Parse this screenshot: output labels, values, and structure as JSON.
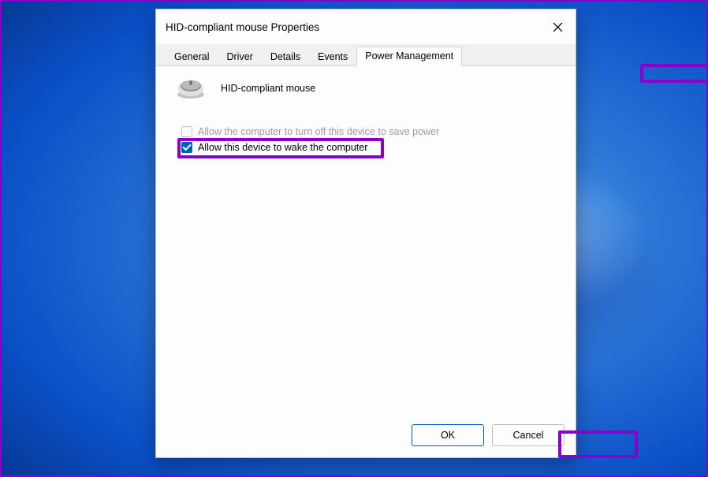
{
  "window": {
    "title": "HID-compliant mouse Properties"
  },
  "tabs": {
    "general": "General",
    "driver": "Driver",
    "details": "Details",
    "events": "Events",
    "power_management": "Power Management"
  },
  "device": {
    "name": "HID-compliant mouse"
  },
  "options": {
    "turn_off_label": "Allow the computer to turn off this device to save power",
    "turn_off_checked": false,
    "turn_off_enabled": false,
    "wake_label": "Allow this device to wake the computer",
    "wake_checked": true,
    "wake_enabled": true
  },
  "buttons": {
    "ok": "OK",
    "cancel": "Cancel"
  },
  "colors": {
    "highlight": "#8a00cc",
    "accent": "#005fb8"
  }
}
